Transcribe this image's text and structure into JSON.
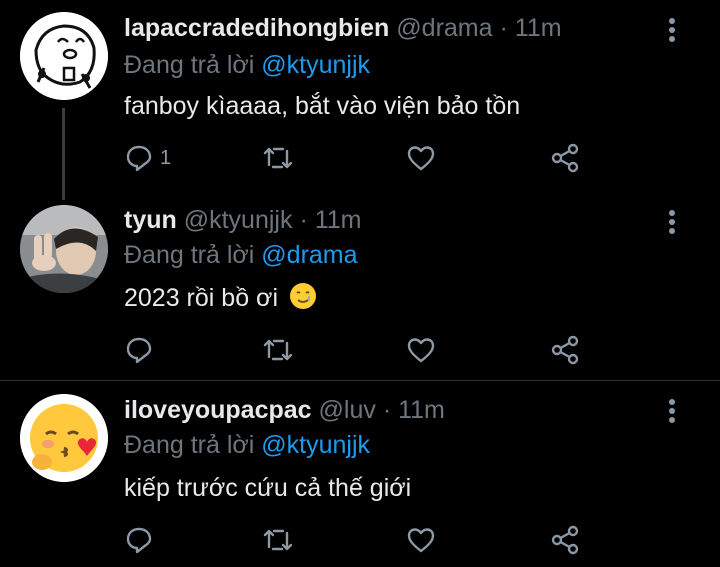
{
  "tweets": [
    {
      "name": "lapaccradedihongbien",
      "handle": "@drama",
      "dot": "·",
      "time": "11m",
      "replying_prefix": "Đang trả lời",
      "replying_to": "@ktyunjjk",
      "text": "fanboy kìaaaa, bắt vào viện bảo tồn",
      "reply_count": "1",
      "avatar_icon": "meme-face-drawing"
    },
    {
      "name": "tyun",
      "handle": "@ktyunjjk",
      "dot": "·",
      "time": "11m",
      "replying_prefix": "Đang trả lời",
      "replying_to": "@drama",
      "text": "2023 rồi bồ ơi",
      "emoji": "smiling-face-with-tear-emoji",
      "reply_count": "",
      "avatar_icon": "photo-peace-sign"
    },
    {
      "name": "iloveyoupacpac",
      "handle": "@luv",
      "dot": "·",
      "time": "11m",
      "replying_prefix": "Đang trả lời",
      "replying_to": "@ktyunjjk",
      "text": "kiếp trước cứu cả thế giới",
      "reply_count": "",
      "avatar_icon": "kissing-face-emoji"
    }
  ],
  "colors": {
    "background": "#000000",
    "text": "#e7e9ea",
    "muted": "#6e767d",
    "mention": "#1d9bf0",
    "divider": "#2f3336"
  }
}
